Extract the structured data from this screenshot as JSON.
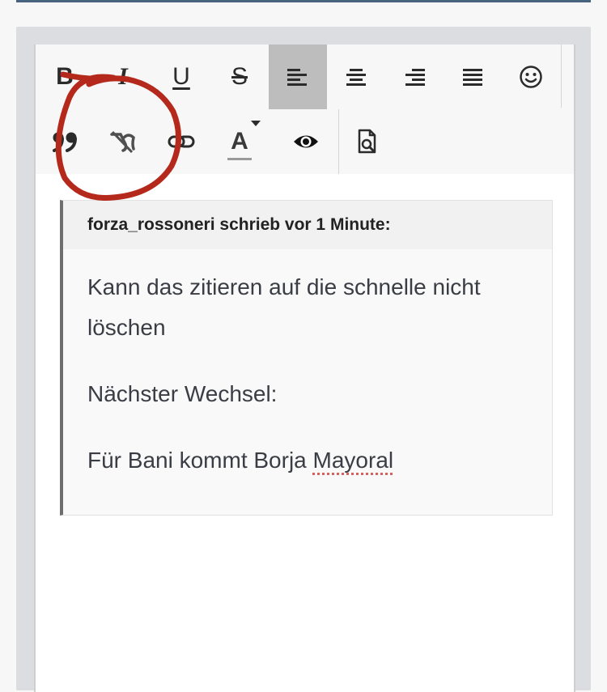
{
  "toolbar": {
    "bold": "B",
    "italic": "I",
    "underline": "U",
    "strikethrough": "S",
    "text_color": "A"
  },
  "quote": {
    "header": "forza_rossoneri schrieb vor 1 Minute:",
    "lines": [
      "Kann das zitieren auf die schnelle nicht löschen",
      "Nächster Wechsel:"
    ],
    "last_prefix": "Für Bani kommt Borja ",
    "last_misspelled": "Mayoral"
  },
  "colors": {
    "annotation": "#b5291c",
    "header_bar": "#48637d",
    "active_button": "#bdbdbd"
  }
}
